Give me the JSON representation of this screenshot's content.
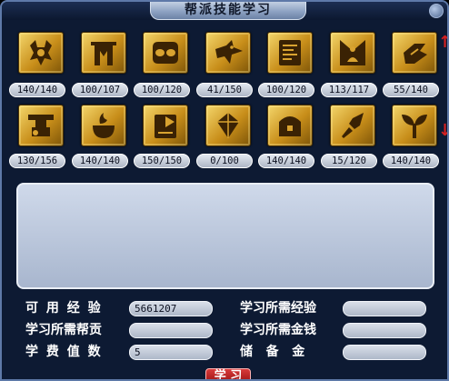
{
  "window": {
    "title": "帮派技能学习"
  },
  "skills": {
    "row1": [
      {
        "icon": "crab-claw-icon",
        "counter": "140/140"
      },
      {
        "icon": "gate-emblem-icon",
        "counter": "100/107"
      },
      {
        "icon": "knot-icon",
        "counter": "100/120"
      },
      {
        "icon": "bird-attack-icon",
        "counter": "41/150"
      },
      {
        "icon": "scroll-figure-icon",
        "counter": "100/120"
      },
      {
        "icon": "meditation-figure-icon",
        "counter": "113/117"
      },
      {
        "icon": "hand-gesture-icon",
        "counter": "55/140"
      }
    ],
    "row2": [
      {
        "icon": "anvil-icon",
        "counter": "130/156"
      },
      {
        "icon": "cauldron-icon",
        "counter": "140/140"
      },
      {
        "icon": "chart-book-icon",
        "counter": "150/150"
      },
      {
        "icon": "gem-hand-icon",
        "counter": "0/100"
      },
      {
        "icon": "treasure-chest-icon",
        "counter": "140/140"
      },
      {
        "icon": "dagger-icon",
        "counter": "15/120"
      },
      {
        "icon": "sprout-icon",
        "counter": "140/140"
      }
    ]
  },
  "scroll": {
    "up_glyph": "↑",
    "down_glyph": "↓"
  },
  "description": {
    "text": ""
  },
  "stats": {
    "available_exp_label": "可 用 经 验",
    "available_exp_value": "5661207",
    "required_exp_label": "学习所需经验",
    "required_exp_value": "",
    "required_contribution_label": "学习所需帮贡",
    "required_contribution_value": "",
    "required_money_label": "学习所需金钱",
    "required_money_value": "",
    "tuition_label": "学 费 值 数",
    "tuition_value": "5",
    "reserve_label": "储   备   金",
    "reserve_value": ""
  },
  "actions": {
    "learn_label": "学 习"
  },
  "colors": {
    "window_bg": "#0d1a33",
    "frame": "#5e79a8",
    "icon_gold": "#d9a330",
    "arrow_red": "#d62020",
    "button_red": "#b51f1f"
  }
}
